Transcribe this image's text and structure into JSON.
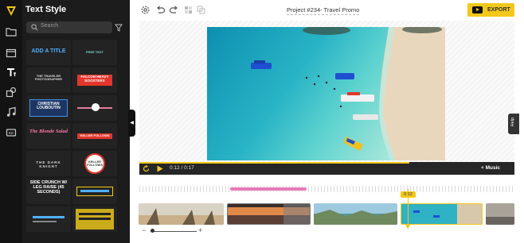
{
  "panel": {
    "title": "Text Style",
    "search_placeholder": "Search"
  },
  "tiles": [
    {
      "text": "ADD A TITLE"
    },
    {
      "text": "FREE TEXT"
    },
    {
      "text": "THE TRAVELER PHOTOGRAPHER"
    },
    {
      "text": "FALCON HEAVY BOOSTERS"
    },
    {
      "text": "CHRISTIAN LOUBOUTIN"
    },
    {
      "text": ""
    },
    {
      "text": "The Blonde Salad"
    },
    {
      "text": "KELLER FOLLOWS"
    },
    {
      "text": "THE DARK KNIGHT"
    },
    {
      "text": "KELLER FOLLOWS"
    },
    {
      "text": "SIDE CRUNCH W/ LEG RAISE (45 SECONDS)"
    },
    {
      "text": ""
    },
    {
      "text": ""
    },
    {
      "text": ""
    }
  ],
  "topbar": {
    "project": "Project #234- Travel Promo",
    "export": "EXPORT"
  },
  "player": {
    "time_current": "0:12",
    "time_sep": "/",
    "time_total": "0:17",
    "music": "+ Music",
    "progress": 0.72
  },
  "help": "Help",
  "timeline": {
    "playhead_label": "0:12",
    "zoom_minus": "−",
    "zoom_plus": "+"
  },
  "colors": {
    "accent": "#f3c81a",
    "panel_bg": "#1c1c1c",
    "text_clip": "#e879b8"
  }
}
